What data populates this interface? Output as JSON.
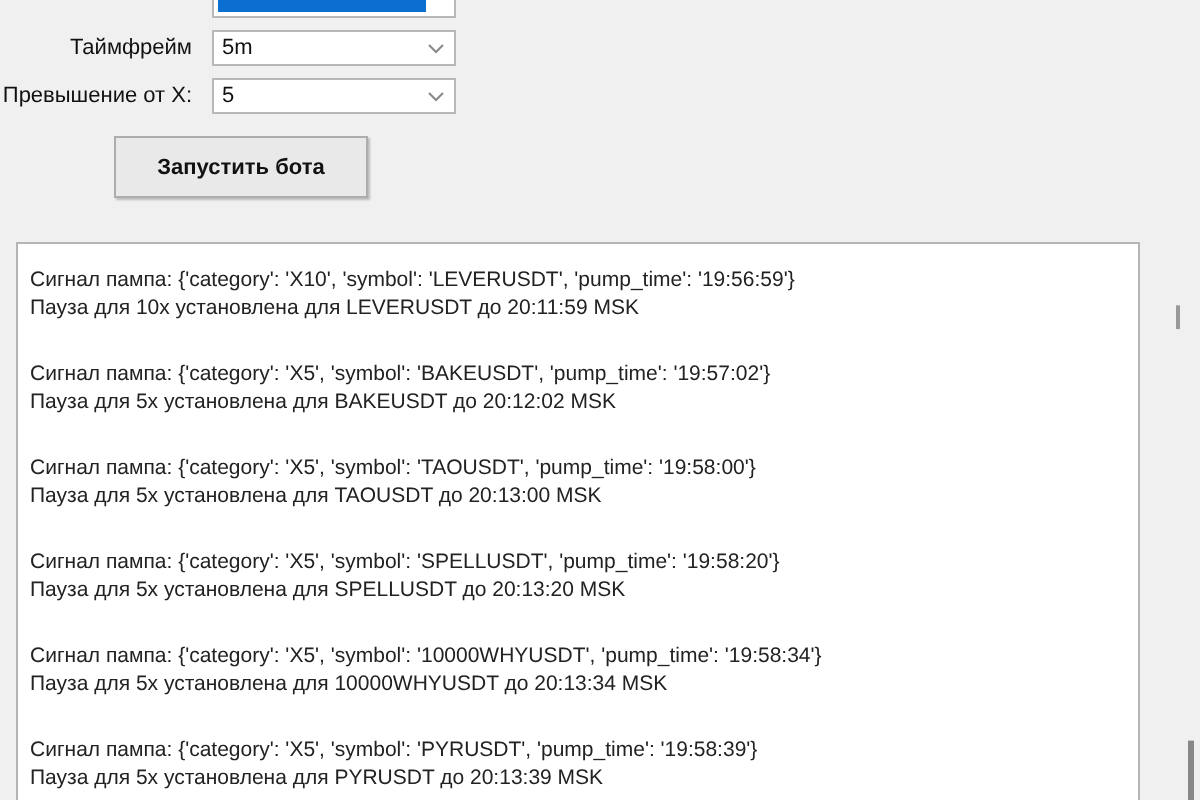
{
  "form": {
    "fields": [
      {
        "label": "Таймфрейм",
        "value": "5m"
      },
      {
        "label": "Превышение от X:",
        "value": "5"
      }
    ],
    "start_button": "Запустить бота"
  },
  "log": [
    {
      "signal": "Сигнал пампа: {'category': 'X10', 'symbol': 'LEVERUSDT', 'pump_time': '19:56:59'}",
      "pause": "Пауза для 10x установлена для LEVERUSDT до 20:11:59 MSK"
    },
    {
      "signal": "Сигнал пампа: {'category': 'X5', 'symbol': 'BAKEUSDT', 'pump_time': '19:57:02'}",
      "pause": "Пауза для 5x установлена для BAKEUSDT до 20:12:02 MSK"
    },
    {
      "signal": "Сигнал пампа: {'category': 'X5', 'symbol': 'TAOUSDT', 'pump_time': '19:58:00'}",
      "pause": "Пауза для 5x установлена для TAOUSDT до 20:13:00 MSK"
    },
    {
      "signal": "Сигнал пампа: {'category': 'X5', 'symbol': 'SPELLUSDT', 'pump_time': '19:58:20'}",
      "pause": "Пауза для 5x установлена для SPELLUSDT до 20:13:20 MSK"
    },
    {
      "signal": "Сигнал пампа: {'category': 'X5', 'symbol': '10000WHYUSDT', 'pump_time': '19:58:34'}",
      "pause": "Пауза для 5x установлена для 10000WHYUSDT до 20:13:34 MSK"
    },
    {
      "signal": "Сигнал пампа: {'category': 'X5', 'symbol': 'PYRUSDT', 'pump_time': '19:58:39'}",
      "pause": "Пауза для 5x установлена для PYRUSDT до 20:13:39 MSK"
    }
  ]
}
